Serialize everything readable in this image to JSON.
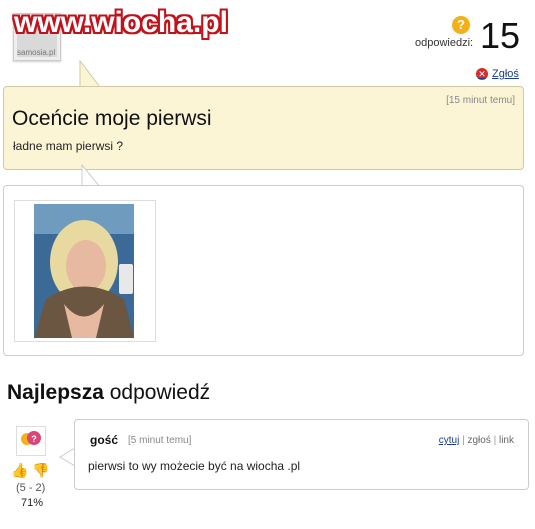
{
  "watermark": "www.wiocha.pl",
  "avatar_brand": "samosia.pl",
  "counter": {
    "label": "odpowiedzi:",
    "value": "15"
  },
  "report_label": "Zgłoś",
  "question": {
    "time": "[15 minut temu]",
    "title": "Oceńcie moje pierwsi",
    "body": "ładne mam pierwsi ?"
  },
  "best_answer": {
    "heading_bold": "Najlepsza",
    "heading_rest": "odpowiedź",
    "author": "gość",
    "time": "[5 minut temu]",
    "actions": {
      "quote": "cytuj",
      "report": "zgłoś",
      "link": "link"
    },
    "text": "pierwsi to wy możecie być na wiocha .pl",
    "vote_score": "(5 - 2)",
    "vote_percent": "71%"
  },
  "colors": {
    "accent_link": "#1b3c8c",
    "question_bg": "#fbf5d6",
    "watermark_red": "#c0121b"
  }
}
